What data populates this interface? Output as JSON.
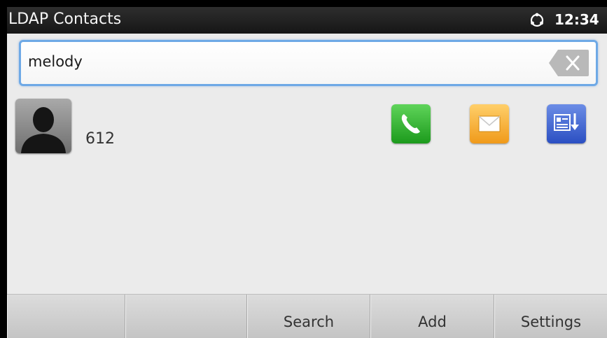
{
  "titlebar": {
    "title": "LDAP Contacts",
    "network_icon": "network-globe-icon",
    "time": "12:34"
  },
  "search": {
    "value": "melody",
    "clear_icon": "clear-x-icon"
  },
  "contacts": [
    {
      "number": "612",
      "avatar_icon": "person-silhouette-icon",
      "actions": [
        "phone-icon",
        "envelope-icon",
        "download-contact-icon"
      ]
    }
  ],
  "softkeys": [
    "",
    "",
    "Search",
    "Add",
    "Settings"
  ],
  "colors": {
    "titlebar": "#1f1f1f",
    "background": "#ebebeb",
    "focus_border": "#6ea9e6",
    "call": "#2cb02a",
    "message": "#f5b13c",
    "download": "#3f63d6"
  }
}
